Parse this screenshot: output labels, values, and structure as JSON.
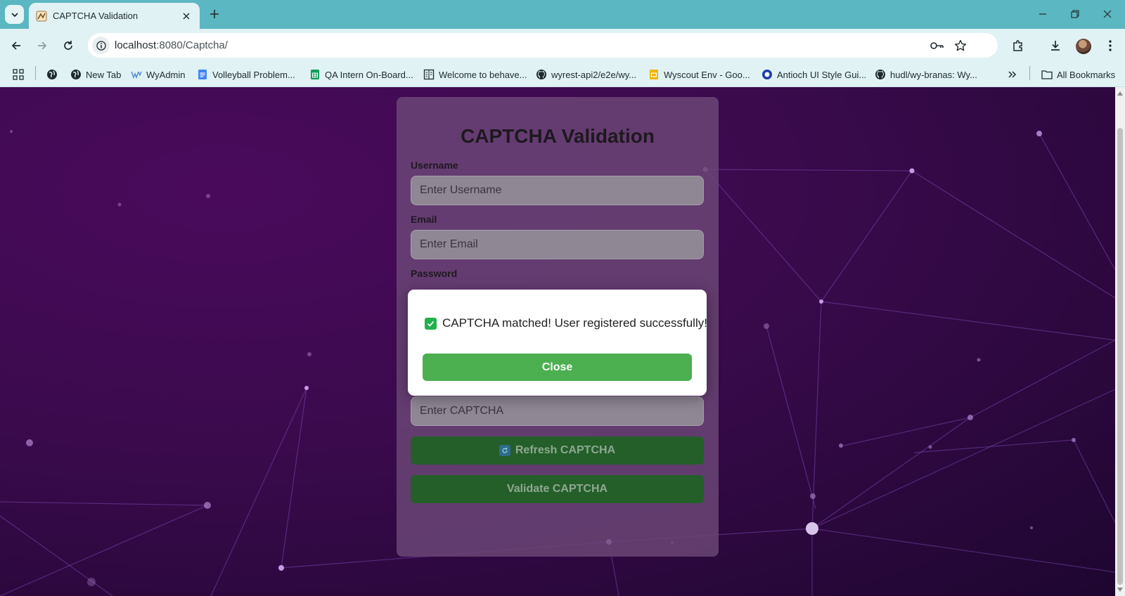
{
  "browser": {
    "tab_title": "CAPTCHA Validation",
    "url_host": "localhost",
    "url_path": ":8080/Captcha/",
    "bookmarks": [
      {
        "label": "New Tab"
      },
      {
        "label": "WyAdmin"
      },
      {
        "label": "Volleyball Problem..."
      },
      {
        "label": "QA Intern On-Board..."
      },
      {
        "label": "Welcome to behave..."
      },
      {
        "label": "wyrest-api2/e2e/wy..."
      },
      {
        "label": "Wyscout Env - Goo..."
      },
      {
        "label": "Antioch UI Style Gui..."
      },
      {
        "label": "hudl/wy-branas: Wy..."
      }
    ],
    "all_bookmarks": "All Bookmarks"
  },
  "form": {
    "title": "CAPTCHA Validation",
    "username_label": "Username",
    "username_placeholder": "Enter Username",
    "email_label": "Email",
    "email_placeholder": "Enter Email",
    "password_label": "Password",
    "captcha_placeholder": "Enter CAPTCHA",
    "refresh_label": "Refresh CAPTCHA",
    "validate_label": "Validate CAPTCHA"
  },
  "modal": {
    "message": "CAPTCHA matched! User registered successfully!",
    "close_label": "Close"
  },
  "colors": {
    "chrome": "#5bb7c2",
    "toolbar": "#e0f2f4",
    "success": "#4caf50",
    "button_dark": "#245f2a"
  }
}
